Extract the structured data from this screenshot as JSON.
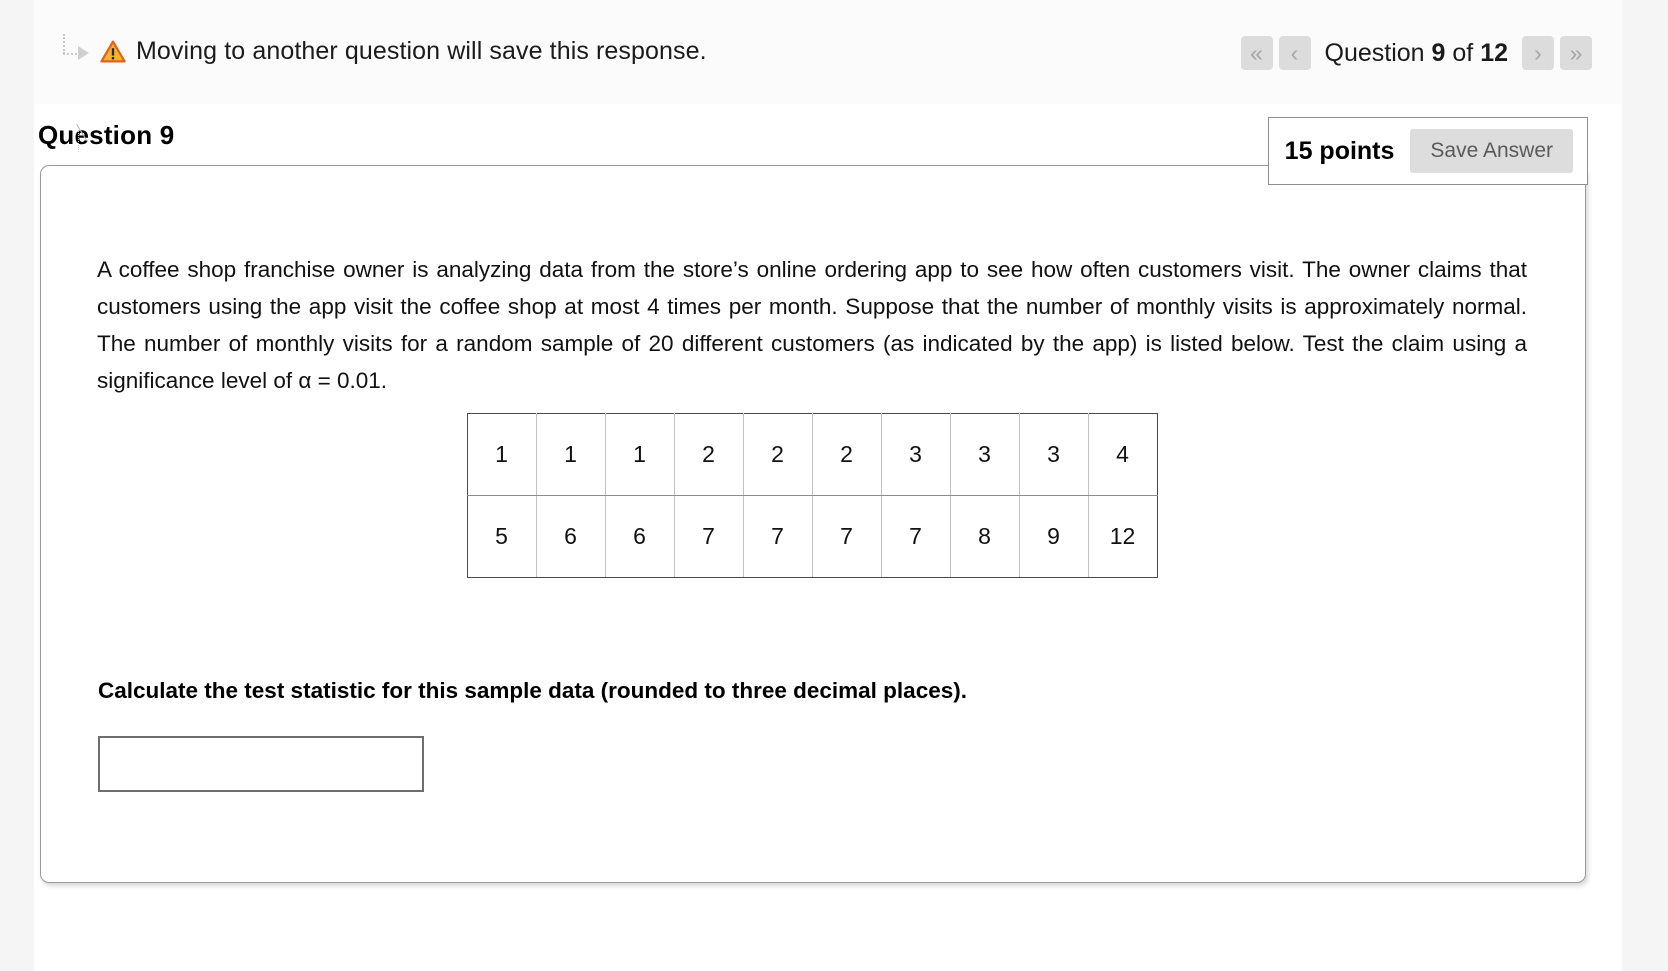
{
  "banner": {
    "icons": {
      "turn_arrow": "turn-right-arrow-icon",
      "warning": "warning-triangle-icon"
    },
    "message": "Moving to another question will save this response."
  },
  "question_nav": {
    "first_label": "«",
    "prev_label": "‹",
    "next_label": "›",
    "last_label": "»",
    "prefix": "Question",
    "current": "9",
    "middle": "of",
    "total": "12"
  },
  "question": {
    "heading": "Question 9",
    "points_label": "15 points",
    "save_button": "Save Answer",
    "body_text": "A coffee shop franchise owner is analyzing data from the store’s online ordering app to see how often customers visit. The owner claims that customers using the app visit the coffee shop at most 4 times per month. Suppose that the number of monthly visits is approximately normal. The number of monthly visits for a random sample of 20 different customers (as indicated by the app) is listed below. Test the claim using a significance level of α = 0.01.",
    "prompt": "Calculate the test statistic for this sample data (rounded to three decimal places).",
    "answer_value": "",
    "answer_placeholder": ""
  },
  "data_table": {
    "rows": [
      [
        "1",
        "1",
        "1",
        "2",
        "2",
        "2",
        "3",
        "3",
        "3",
        "4"
      ],
      [
        "5",
        "6",
        "6",
        "7",
        "7",
        "7",
        "7",
        "8",
        "9",
        "12"
      ]
    ]
  },
  "colors": {
    "page_background": "#ffffff",
    "gutter": "#f5f5f5",
    "banner_background": "#fbfbfb",
    "nav_button": "#dcdcdc",
    "save_button": "#dddddd",
    "warning_fill": "#f6b331",
    "warning_stroke": "#e3621f",
    "card_border": "#9a9a9a",
    "text": "#111111"
  }
}
